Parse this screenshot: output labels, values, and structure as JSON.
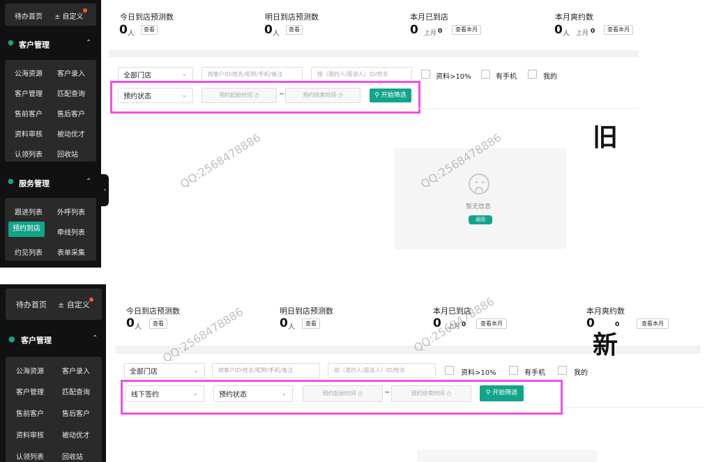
{
  "nav_top": {
    "home": "待办首页",
    "custom": "± 自定义"
  },
  "customer_section": {
    "title": "客户管理",
    "items": [
      "公海资源",
      "客户录入",
      "客户管理",
      "匹配查询",
      "售前客户",
      "售后客户",
      "资料审核",
      "被动优才",
      "认领列表",
      "回收站"
    ]
  },
  "service_section": {
    "title": "服务管理",
    "items": [
      "跟进列表",
      "外呼列表",
      "预约到店",
      "牵线列表",
      "约见列表",
      "表单采集"
    ],
    "active": "预约到店"
  },
  "stats": {
    "today": {
      "label": "今日到店预测数",
      "value": "0",
      "unit": "人",
      "btn": "查看"
    },
    "tomorrow": {
      "label": "明日到店预测数",
      "value": "0",
      "unit": "人",
      "btn": "查看"
    },
    "month_arrived": {
      "label": "本月已到店",
      "value": "0",
      "last_label": "上月",
      "last_value": "0",
      "btn": "查看本月"
    },
    "month_missed": {
      "label": "本月爽约数",
      "value": "0",
      "unit": "人",
      "last_label": "上月",
      "last_value": "0",
      "btn": "查看本月"
    }
  },
  "filters": {
    "store": "全部门店",
    "search_placeholder": "按客户ID/姓名/昵称/手机/备注",
    "inviter_placeholder": "按（邀约人/面谈人）ID/姓名",
    "chk_profile": "资料>10%",
    "chk_phone": "有手机",
    "chk_mine": "我的",
    "sign_select": "线下签约",
    "status_select": "预约状态",
    "start_placeholder": "预约起始时间",
    "end_placeholder": "预约结束时间",
    "tilde": "~",
    "go": "开始筛选"
  },
  "empty": {
    "text": "暂无信息",
    "back": "返回"
  },
  "labels": {
    "old": "旧",
    "new": "新"
  },
  "watermark": "QQ:2568478886",
  "colors": {
    "accent": "#12a58a",
    "highlight": "#f24fe3",
    "sidebar": "#111111"
  }
}
